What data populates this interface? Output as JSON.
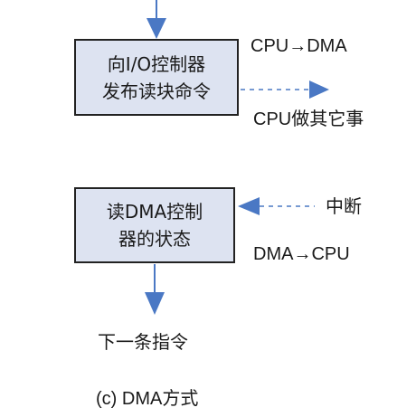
{
  "box_issue_command": {
    "line1": "向I/O控制器",
    "line2": "发布读块命令"
  },
  "box_read_status": {
    "line1": "读DMA控制",
    "line2": "器的状态"
  },
  "labels": {
    "cpu_to_dma": "CPU→DMA",
    "cpu_other_work": "CPU做其它事",
    "interrupt": "中断",
    "dma_to_cpu": "DMA→CPU",
    "next_instruction": "下一条指令"
  },
  "caption": "(c) DMA方式",
  "colors": {
    "box_fill": "#dde3f1",
    "box_border": "#222222",
    "arrow": "#4a78c4"
  }
}
